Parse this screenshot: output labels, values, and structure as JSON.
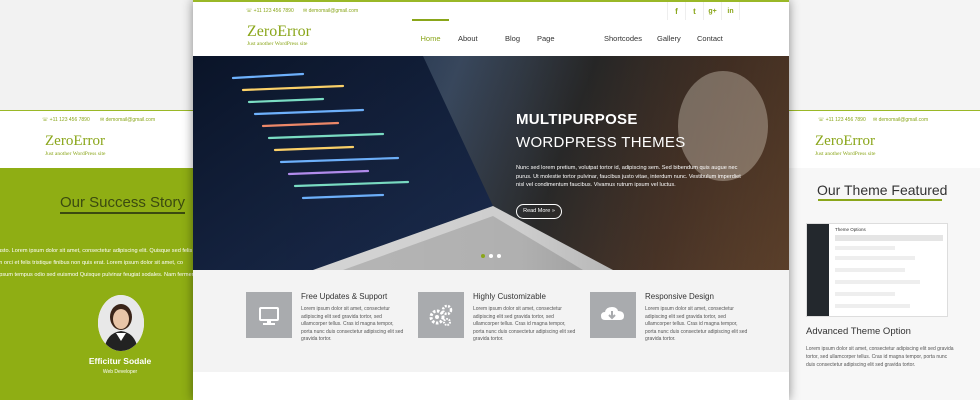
{
  "site": {
    "logo": "ZeroError",
    "tagline": "Just another WordPress site",
    "phone": "+11 123 456 7890",
    "email": "demomail@gmail.com",
    "social": [
      "facebook-icon",
      "twitter-icon",
      "google-plus-icon",
      "linkedin-icon"
    ]
  },
  "nav": {
    "items": [
      "Home",
      "About Us",
      "Blog",
      "Page Templates",
      "Shortcodes",
      "Gallery",
      "Contact Us"
    ],
    "active": "Home"
  },
  "hero": {
    "title_line1": "MULTIPURPOSE",
    "title_line2": "WORDPRESS THEMES",
    "description": "Nunc sed lorem pretium, volutpat tortor id, adipiscing sem. Sed bibendum quis augue nec purus. Ut molestie tortor pulvinar, faucibus justo vitae, interdum nunc. Vestibulum imperdiet nisl vel condimentum faucibus. Vivamus rutrum ipsum vel luctus.",
    "button": "Read More »"
  },
  "features": [
    {
      "title": "Free Updates & Support",
      "text": "Lorem ipsum dolor sit amet, consectetur adipiscing elit sed gravida tortor, sed ullamcorper tellus. Cras id magna tempor, porta nunc duis consectetur adipiscing elit sed gravida tortor.",
      "icon": "monitor-icon"
    },
    {
      "title": "Highly Customizable",
      "text": "Lorem ipsum dolor sit amet, consectetur adipiscing elit sed gravida tortor, sed ullamcorper tellus. Cras id magna tempor, porta nunc duis consectetur adipiscing elit sed gravida tortor.",
      "icon": "gears-icon"
    },
    {
      "title": "Responsive Design",
      "text": "Lorem ipsum dolor sit amet, consectetur adipiscing elit sed gravida tortor, sed ullamcorper tellus. Cras id magna tempor, porta nunc duis consectetur adipiscing elit sed gravida tortor.",
      "icon": "cloud-download-icon"
    }
  ],
  "left": {
    "section_title": "Our Success Story",
    "story_lines": [
      "usto. Lorem ipsum dolor sit amet, consectetur adipiscing elit. Quisque sed felis",
      "in orci et felis tristique finibus non quis erat. Lorem ipsum dolor sit amet, co",
      "ipsum tempus odio sed euismod Quisque pulvinar feugiat sodales. Nam fermentu"
    ],
    "person_name": "Efficitur Sodale",
    "person_role": "Web Developer"
  },
  "right": {
    "section_title": "Our Theme Featured",
    "feature_title": "Advanced Theme Option",
    "feature_text": "Lorem ipsum dolor sit amet, consectetur adipiscing elit sed gravida tortor, sed ullamcorper tellus. Cras id magna tempor, porta nunc duis consectetur adipiscing elit sed gravida tortor.",
    "screenshot_title": "Theme Options"
  },
  "colors": {
    "accent": "#8aa61a",
    "green_panel": "#8fae14"
  }
}
